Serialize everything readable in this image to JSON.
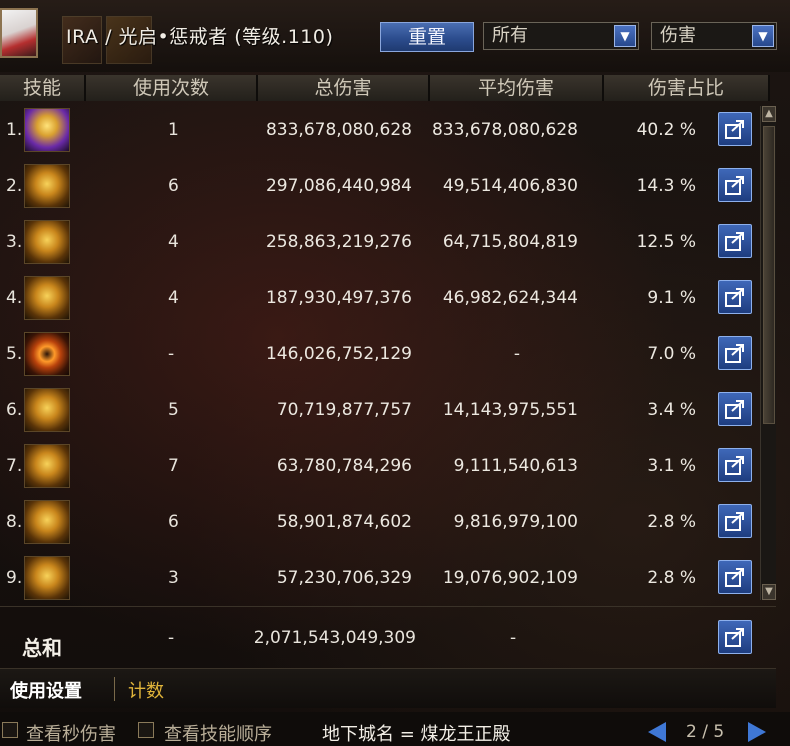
{
  "header": {
    "character_name": "IRA / 光启•惩戒者 (等级.110)",
    "reset_label": "重置",
    "filter_all": "所有",
    "filter_damage": "伤害"
  },
  "columns": {
    "skill": "技能",
    "uses": "使用次数",
    "total": "总伤害",
    "average": "平均伤害",
    "share": "伤害占比"
  },
  "rows": [
    {
      "index": "1.",
      "uses": "1",
      "total": "833,678,080,628",
      "average": "833,678,080,628",
      "share": "40.2 %",
      "icon": "purple"
    },
    {
      "index": "2.",
      "uses": "6",
      "total": "297,086,440,984",
      "average": "49,514,406,830",
      "share": "14.3 %",
      "icon": "gold"
    },
    {
      "index": "3.",
      "uses": "4",
      "total": "258,863,219,276",
      "average": "64,715,804,819",
      "share": "12.5 %",
      "icon": "gold"
    },
    {
      "index": "4.",
      "uses": "4",
      "total": "187,930,497,376",
      "average": "46,982,624,344",
      "share": "9.1 %",
      "icon": "gold"
    },
    {
      "index": "5.",
      "uses": "-",
      "total": "146,026,752,129",
      "average": "-",
      "share": "7.0 %",
      "icon": "ring"
    },
    {
      "index": "6.",
      "uses": "5",
      "total": "70,719,877,757",
      "average": "14,143,975,551",
      "share": "3.4 %",
      "icon": "gold"
    },
    {
      "index": "7.",
      "uses": "7",
      "total": "63,780,784,296",
      "average": "9,111,540,613",
      "share": "3.1 %",
      "icon": "gold"
    },
    {
      "index": "8.",
      "uses": "6",
      "total": "58,901,874,602",
      "average": "9,816,979,100",
      "share": "2.8 %",
      "icon": "gold"
    },
    {
      "index": "9.",
      "uses": "3",
      "total": "57,230,706,329",
      "average": "19,076,902,109",
      "share": "2.8 %",
      "icon": "gold"
    }
  ],
  "totals": {
    "label": "总和",
    "uses": "-",
    "total": "2,071,543,049,309",
    "average": "-"
  },
  "tabs": {
    "usage": "使用设置",
    "count": "计数"
  },
  "bottom": {
    "view_dps": "查看秒伤害",
    "view_order": "查看技能顺序",
    "dungeon": "地下城名 = 煤龙王正殿",
    "page": "2 / 5"
  }
}
